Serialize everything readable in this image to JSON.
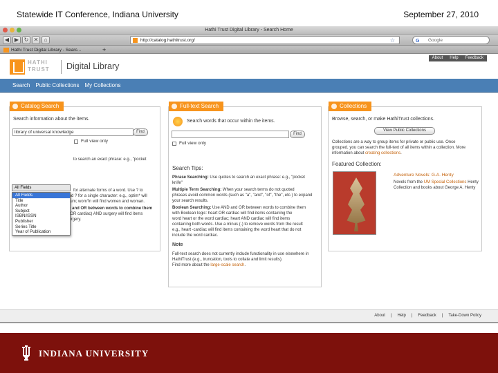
{
  "slide": {
    "header_left": "Statewide IT Conference, Indiana University",
    "header_right": "September 27, 2010",
    "footer_brand": "INDIANA UNIVERSITY"
  },
  "browser": {
    "window_title": "Hathi Trust Digital Library - Search Home",
    "url": "http://catalog.hathitrust.org/",
    "search_engine": "Google",
    "tab_label": "Hathi Trust Digital Library - Searc..."
  },
  "site": {
    "logo_text_line1": "HATHI",
    "logo_text_line2": "TRUST",
    "logo_product": "Digital Library",
    "top_links": [
      "About",
      "Help",
      "Feedback"
    ],
    "nav": [
      "Search",
      "Public Collections",
      "My Collections"
    ],
    "footer_links": [
      "About",
      "Help",
      "Feedback",
      "Take-Down Policy"
    ],
    "footer_separators": [
      "|",
      "|",
      "|"
    ]
  },
  "catalog": {
    "tab_label": "Catalog Search",
    "heading": "Search information about the items.",
    "query": "library of universal knowledge",
    "find_label": "Find",
    "field_selected": "All Fields",
    "full_view_label": "Full view only",
    "field_options": [
      "All Fields",
      "Title",
      "Author",
      "Subject",
      "ISBN/ISSN",
      "Publisher",
      "Series Title",
      "Year of Publication"
    ],
    "help_text_1": "to search an exact phrase: e.g., \"pocket",
    "help_text_2": "for alternate forms of a word. Use ? to",
    "help_text_3": "stand for several characters, and ? for a single character: e.g., optim* will",
    "help_text_4": "find optimal, optimistic or optimum; wom?n will find women and woman.",
    "help_text_5": "Boolean Searching: Use AND and OR between words to combine them",
    "help_text_6": "with Boolean logic: e.g., (heart OR cardiac) AND surgery will find items",
    "help_text_7": "with heart surgery or cardiac surgery."
  },
  "fulltext": {
    "tab_label": "Full-text Search",
    "heading": "Search words that occur within the items.",
    "find_label": "Find",
    "full_view_label": "Full view only",
    "tips_title": "Search Tips:",
    "tip1_bold": "Phrase Searching:",
    "tip1_a": "Use quotes to search an exact phrase: e.g., \"pocket",
    "tip1_b": "knife\"",
    "tip2_bold": "Multiple Term Searching:",
    "tip2_a": "When your search terms do not quoted",
    "tip2_b": "phrases avoid common words (such as \"a\", \"and\", \"of\", \"the\", etc.) to expand",
    "tip2_c": "your search results.",
    "tip3_bold": "Boolean Searching:",
    "tip3_a": "Use AND and OR between words to combine them",
    "tip3_b": "with Boolean logic: heart OR cardiac will find items containing the",
    "tip3_c": "word heart or the word cardiac; heart AND cardiac will find items",
    "tip3_d": "containing both words. Use a minus (-) to remove words from the result",
    "tip3_e": "e.g., heart -cardiac will find items containing the word heart that do not",
    "tip3_f": "include the word cardiac.",
    "note_title": "Note",
    "note_a": "Full-text search does not currently include functionality in use elsewhere in",
    "note_b": "HathiTrust (e.g., truncation, tools to collate and limit results).",
    "note_c": "Find more about the",
    "note_link": "large-scale search",
    "note_d": "."
  },
  "collections": {
    "tab_label": "Collections",
    "heading": "Browse, search, or make HathiTrust collections.",
    "view_button": "View Public Collections",
    "desc_a": "Collections are a way to group items for private or public use. Once",
    "desc_b": "grouped, you can search the full-text of all items within a collection. More",
    "desc_c": "information about",
    "desc_link": "creating collections",
    "desc_d": ".",
    "featured_title": "Featured Collection:",
    "featured_name": "Adventure Novels: G.A. Henty",
    "featured_desc_a": "Novels from the",
    "featured_desc_link": "UM Special Collections",
    "featured_desc_b": "Henty",
    "featured_desc_c": "Collection and books about George A. Henty"
  },
  "colors": {
    "hathi_orange": "#f7941d",
    "hathi_blue_nav": "#4a7fb5",
    "iu_crimson": "#7d110c"
  }
}
